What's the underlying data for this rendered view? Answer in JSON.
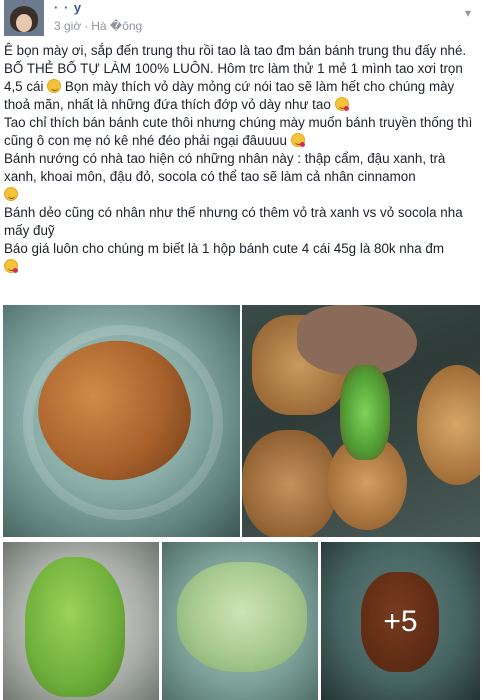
{
  "post": {
    "author": "·   ·       y",
    "time": "3 giờ",
    "location": "Hà �ông",
    "paragraphs": [
      "Ê bọn mày ơi, sắp đến trung thu rồi tao là tao đm bán bánh trung thu đấy nhé. BỐ THẺ BỐ TỰ LÀM 100% LUÔN. Hôm trc làm thử 1 mẻ 1 mình tao xơi trọn 4,5 cái",
      "Bọn mày thích vỏ dày mỏng cứ nói tao sẽ làm hết cho chúng mày thoả mãn, nhất là những đứa thích đớp vỏ dày như tao",
      "Tao chỉ thích bán bánh cute thôi nhưng chúng mày muốn bánh truyền thống thì cũng ô con mẹ nó kê nhé đéo phải ngại đâuuuu",
      "Bánh nướng có nhà tao hiện có những nhân này : thập cẩm, đậu xanh, trà xanh, khoai môn, đậu đỏ, socola có thể tao sẽ làm cả nhân cinnamon",
      "Bánh dẻo cũng có nhân như thế nhưng có thêm vỏ trà xanh vs vỏ socola nha mấy đuỹ",
      "Báo giá luôn cho chúng m biết là 1 hộp bánh cute 4 cái 45g là 80k nha đm"
    ],
    "more_photos": "+5"
  },
  "icons": {
    "globe": "globe-icon",
    "chevron": "chevron-down-icon",
    "emoji": "emoji-icon"
  }
}
